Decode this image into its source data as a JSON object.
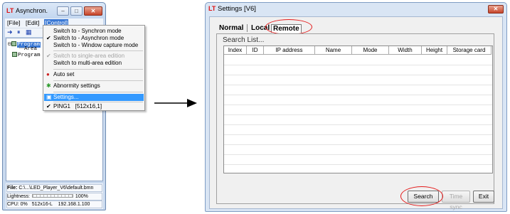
{
  "left_window": {
    "logo": "LT",
    "title": "Asynchron.",
    "menu": [
      "[File]",
      "[Edit]",
      "[Control]"
    ],
    "toolbar_icons": [
      "forward-icon",
      "pause-icon",
      "grid-icon"
    ],
    "tree": {
      "node1": "Program",
      "node1_child": "Area",
      "node2": "Program"
    },
    "status": {
      "file_label": "File:",
      "file_path": "C:\\...\\LED_Player_V6\\default.bmn",
      "lightness_label": "Lightness:",
      "lightness_value": "100%",
      "cpu": "CPU: 0%",
      "size": "512x16-L",
      "ip": "192.168.1.100"
    }
  },
  "control_menu": {
    "items": [
      {
        "label": "Switch to - Synchron mode",
        "checked": false,
        "disabled": false,
        "icon": ""
      },
      {
        "label": "Switch to - Asynchron mode",
        "checked": true,
        "disabled": false,
        "icon": ""
      },
      {
        "label": "Switch to - Window capture mode",
        "checked": false,
        "disabled": false,
        "icon": ""
      },
      {
        "label": "Switch to single-area edition",
        "checked": true,
        "disabled": true,
        "icon": ""
      },
      {
        "label": "Switch to multi-area edition",
        "checked": false,
        "disabled": false,
        "icon": ""
      },
      {
        "label": "Auto set",
        "checked": false,
        "disabled": false,
        "icon": "auto-set-icon"
      },
      {
        "label": "Abnormity settings",
        "checked": false,
        "disabled": false,
        "icon": "abnormity-icon"
      },
      {
        "label": "Settings...",
        "checked": false,
        "disabled": false,
        "icon": "settings-icon",
        "highlighted": true
      },
      {
        "label": "PING1   [512x16,1]",
        "checked": true,
        "disabled": false,
        "icon": ""
      }
    ]
  },
  "settings_window": {
    "logo": "LT",
    "title": "Settings [V6]",
    "tabs": [
      "Normal",
      "Local",
      "Remote"
    ],
    "active_tab": "Remote",
    "search_list_label": "Search List...",
    "columns": [
      "Index",
      "ID",
      "IP address",
      "Name",
      "Mode",
      "Width",
      "Height",
      "Storage card"
    ],
    "buttons": {
      "search": "Search",
      "time_sync": "Time sync",
      "exit": "Exit"
    }
  },
  "colors": {
    "annotation_circle": "#e41b1b",
    "menu_highlight": "#3399ff",
    "logo": "#dd1111"
  }
}
